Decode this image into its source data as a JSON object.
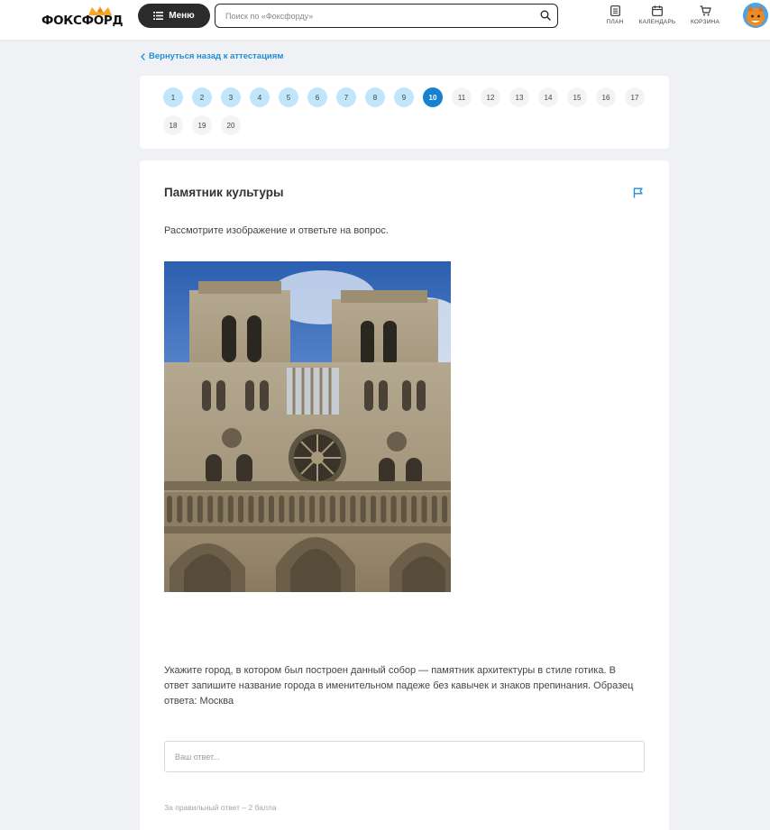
{
  "header": {
    "logo_text": "ФОКСФОРД",
    "menu_label": "Меню",
    "search_placeholder": "Поиск по «Фоксфорду»",
    "nav": [
      {
        "label": "ПЛАН",
        "icon": "plan-icon"
      },
      {
        "label": "КАЛЕНДАРЬ",
        "icon": "calendar-icon"
      },
      {
        "label": "КОРЗИНА",
        "icon": "cart-icon"
      }
    ]
  },
  "back_link": "Вернуться назад к аттестациям",
  "pagination": {
    "current": 10,
    "pages": [
      {
        "label": "1",
        "state": "answered"
      },
      {
        "label": "2",
        "state": "answered"
      },
      {
        "label": "3",
        "state": "answered"
      },
      {
        "label": "4",
        "state": "answered"
      },
      {
        "label": "5",
        "state": "answered"
      },
      {
        "label": "6",
        "state": "answered"
      },
      {
        "label": "7",
        "state": "answered"
      },
      {
        "label": "8",
        "state": "answered"
      },
      {
        "label": "9",
        "state": "answered"
      },
      {
        "label": "10",
        "state": "current"
      },
      {
        "label": "11",
        "state": "pending"
      },
      {
        "label": "12",
        "state": "pending"
      },
      {
        "label": "13",
        "state": "pending"
      },
      {
        "label": "14",
        "state": "pending"
      },
      {
        "label": "15",
        "state": "pending"
      },
      {
        "label": "16",
        "state": "pending"
      },
      {
        "label": "17",
        "state": "pending"
      },
      {
        "label": "18",
        "state": "pending"
      },
      {
        "label": "19",
        "state": "pending"
      },
      {
        "label": "20",
        "state": "pending"
      }
    ]
  },
  "task": {
    "title": "Памятник культуры",
    "instruction": "Рассмотрите изображение и ответьте на вопрос.",
    "question": "Укажите город, в котором был построен данный собор — памятник архитектуры в стиле готика. В ответ запишите название города в именительном падеже без кавычек и знаков препинания. Образец ответа: Москва",
    "answer_placeholder": "Ваш ответ...",
    "score_note": "За правильный ответ – 2 балла"
  },
  "colors": {
    "accent": "#1780d0",
    "answered": "#c4e4fa",
    "link": "#1f8ed5"
  }
}
